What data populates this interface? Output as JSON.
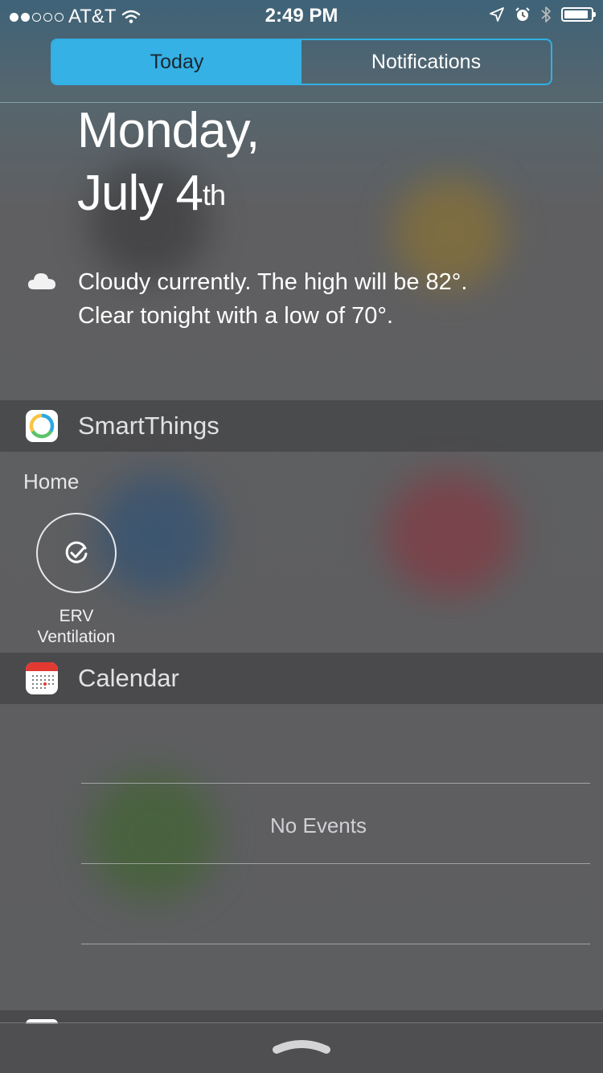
{
  "status_bar": {
    "carrier": "AT&T",
    "time": "2:49 PM"
  },
  "segments": {
    "today": "Today",
    "notifications": "Notifications",
    "selected": "Today"
  },
  "date": {
    "line1": "Monday,",
    "line2": "July 4",
    "ordinal": "th"
  },
  "weather": {
    "icon": "cloud-icon",
    "line1": "Cloudy currently. The high will be 82°.",
    "line2": "Clear tonight with a low of 70°."
  },
  "smartthings": {
    "title": "SmartThings",
    "location": "Home",
    "routine": {
      "icon": "check-circle-icon",
      "line1": "ERV",
      "line2": "Ventilation"
    }
  },
  "calendar": {
    "title": "Calendar",
    "empty_text": "No Events"
  },
  "colors": {
    "accent": "#36b1e5",
    "smartthings_ring": [
      "#2da8e0",
      "#5cc36a",
      "#f6c544"
    ],
    "calendar_red": "#e23a32"
  }
}
